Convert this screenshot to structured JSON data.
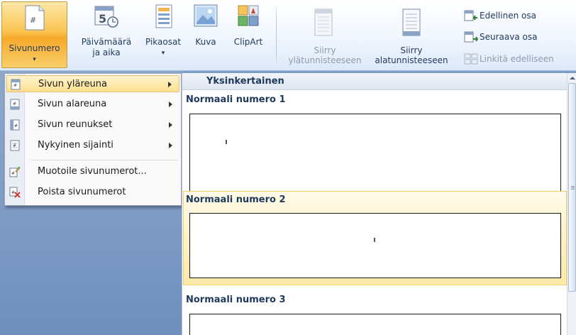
{
  "ribbon": {
    "sivunumero": {
      "line1": "Sivunumero",
      "line2": "▾"
    },
    "paivamaara": {
      "line1": "Päivämäärä",
      "line2": "ja aika"
    },
    "pikaosat": {
      "line1": "Pikaosat",
      "line2": "▾"
    },
    "kuva": {
      "line1": "Kuva"
    },
    "clipart": {
      "line1": "ClipArt"
    },
    "siirry_yla": {
      "line1": "Siirry",
      "line2": "ylätunnisteeseen"
    },
    "siirry_ala": {
      "line1": "Siirry",
      "line2": "alatunnisteeseen"
    },
    "edellinen": "Edellinen osa",
    "seuraava": "Seuraava osa",
    "linkita": "Linkitä edelliseen"
  },
  "menu": {
    "items": [
      {
        "label": "Sivun yläreuna",
        "submenu": true
      },
      {
        "label": "Sivun alareuna",
        "submenu": true
      },
      {
        "label": "Sivun reunukset",
        "submenu": true
      },
      {
        "label": "Nykyinen sijainti",
        "submenu": true
      },
      {
        "label": "Muotoile sivunumerot...",
        "submenu": false
      },
      {
        "label": "Poista sivunumerot",
        "submenu": false
      }
    ]
  },
  "gallery": {
    "header": "Yksinkertainen",
    "items": [
      {
        "title": "Normaali numero 1"
      },
      {
        "title": "Normaali numero 2"
      },
      {
        "title": "Normaali numero 3"
      }
    ]
  },
  "colors": {
    "accent": "#f7a92a",
    "ribbon_text": "#1e395b",
    "highlight": "#fbe9a8"
  }
}
